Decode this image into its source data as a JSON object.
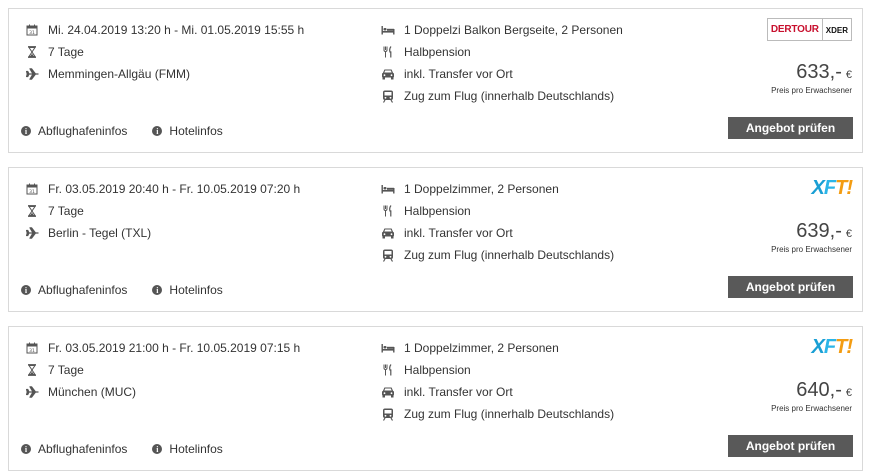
{
  "offers": [
    {
      "dates": "Mi. 24.04.2019 13:20 h - Mi. 01.05.2019 15:55 h",
      "duration": "7 Tage",
      "airport": "Memmingen-Allgäu (FMM)",
      "room": "1 Doppelzi Balkon Bergseite, 2 Personen",
      "board": "Halbpension",
      "transfer": "inkl. Transfer vor Ort",
      "train": "Zug zum Flug (innerhalb Deutschlands)",
      "operator_left": "DERTOUR",
      "operator_right": "XDER",
      "price": "633,-",
      "currency": "€",
      "price_note": "Preis pro Erwachsener",
      "cta_label": "Angebot prüfen",
      "link_airport": "Abflughafeninfos",
      "link_hotel": "Hotelinfos"
    },
    {
      "dates": "Fr. 03.05.2019 20:40 h - Fr. 10.05.2019 07:20 h",
      "duration": "7 Tage",
      "airport": "Berlin - Tegel (TXL)",
      "room": "1 Doppelzimmer, 2 Personen",
      "board": "Halbpension",
      "transfer": "inkl. Transfer vor Ort",
      "train": "Zug zum Flug (innerhalb Deutschlands)",
      "operator": "XFT!",
      "price": "639,-",
      "currency": "€",
      "price_note": "Preis pro Erwachsener",
      "cta_label": "Angebot prüfen",
      "link_airport": "Abflughafeninfos",
      "link_hotel": "Hotelinfos"
    },
    {
      "dates": "Fr. 03.05.2019 21:00 h - Fr. 10.05.2019 07:15 h",
      "duration": "7 Tage",
      "airport": "München (MUC)",
      "room": "1 Doppelzimmer, 2 Personen",
      "board": "Halbpension",
      "transfer": "inkl. Transfer vor Ort",
      "train": "Zug zum Flug (innerhalb Deutschlands)",
      "operator": "XFT!",
      "price": "640,-",
      "currency": "€",
      "price_note": "Preis pro Erwachsener",
      "cta_label": "Angebot prüfen",
      "link_airport": "Abflughafeninfos",
      "link_hotel": "Hotelinfos"
    }
  ],
  "icons": {
    "calendar": "calendar-icon",
    "duration": "hourglass-icon",
    "flight": "airplane-icon",
    "room": "bed-icon",
    "board": "cutlery-icon",
    "transfer": "car-icon",
    "train": "train-icon",
    "info": "info-icon"
  },
  "colors": {
    "cta_bg": "#595959",
    "border": "#d9d9d9",
    "dertour_red": "#c8102e",
    "xft_blue": "#1a9fd4",
    "xft_orange": "#f39c12"
  }
}
